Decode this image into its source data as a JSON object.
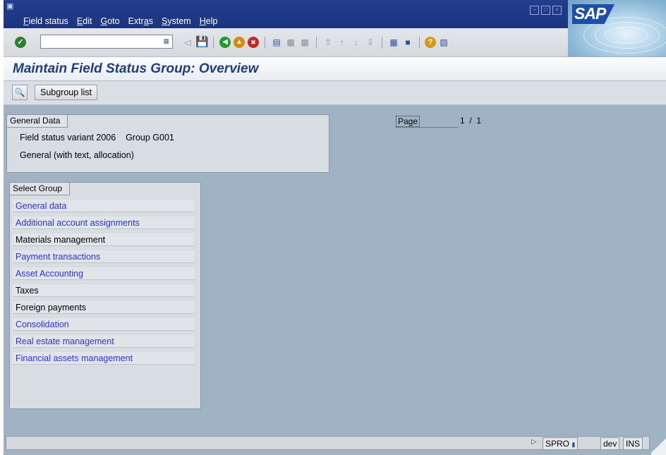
{
  "menu": {
    "items": [
      {
        "pre": "",
        "u": "F",
        "post": "ield status"
      },
      {
        "pre": "",
        "u": "E",
        "post": "dit"
      },
      {
        "pre": "",
        "u": "G",
        "post": "oto"
      },
      {
        "pre": "Extr",
        "u": "a",
        "post": "s"
      },
      {
        "pre": "",
        "u": "S",
        "post": "ystem"
      },
      {
        "pre": "",
        "u": "H",
        "post": "elp"
      }
    ]
  },
  "logo": {
    "text": "SAP"
  },
  "toolbar": {
    "command_value": ""
  },
  "title": "Maintain Field Status Group: Overview",
  "app_toolbar": {
    "subgroup_label": "Subgroup list"
  },
  "general": {
    "title": "General Data",
    "variant_line": "Field status variant 2006    Group G001",
    "description": "General (with text, allocation)"
  },
  "page": {
    "label": "Page",
    "value": "1  /  1"
  },
  "select_group": {
    "title": "Select Group",
    "items": [
      {
        "label": "General data",
        "link": true
      },
      {
        "label": "Additional account assignments",
        "link": true
      },
      {
        "label": "Materials management",
        "link": false
      },
      {
        "label": "Payment transactions",
        "link": true
      },
      {
        "label": "Asset Accounting",
        "link": true
      },
      {
        "label": "Taxes",
        "link": false
      },
      {
        "label": "Foreign payments",
        "link": false
      },
      {
        "label": "Consolidation",
        "link": true
      },
      {
        "label": "Real estate management",
        "link": true
      },
      {
        "label": "Financial assets management",
        "link": true
      }
    ]
  },
  "status": {
    "transaction": "SPRO",
    "server": "dev",
    "mode": "INS"
  }
}
